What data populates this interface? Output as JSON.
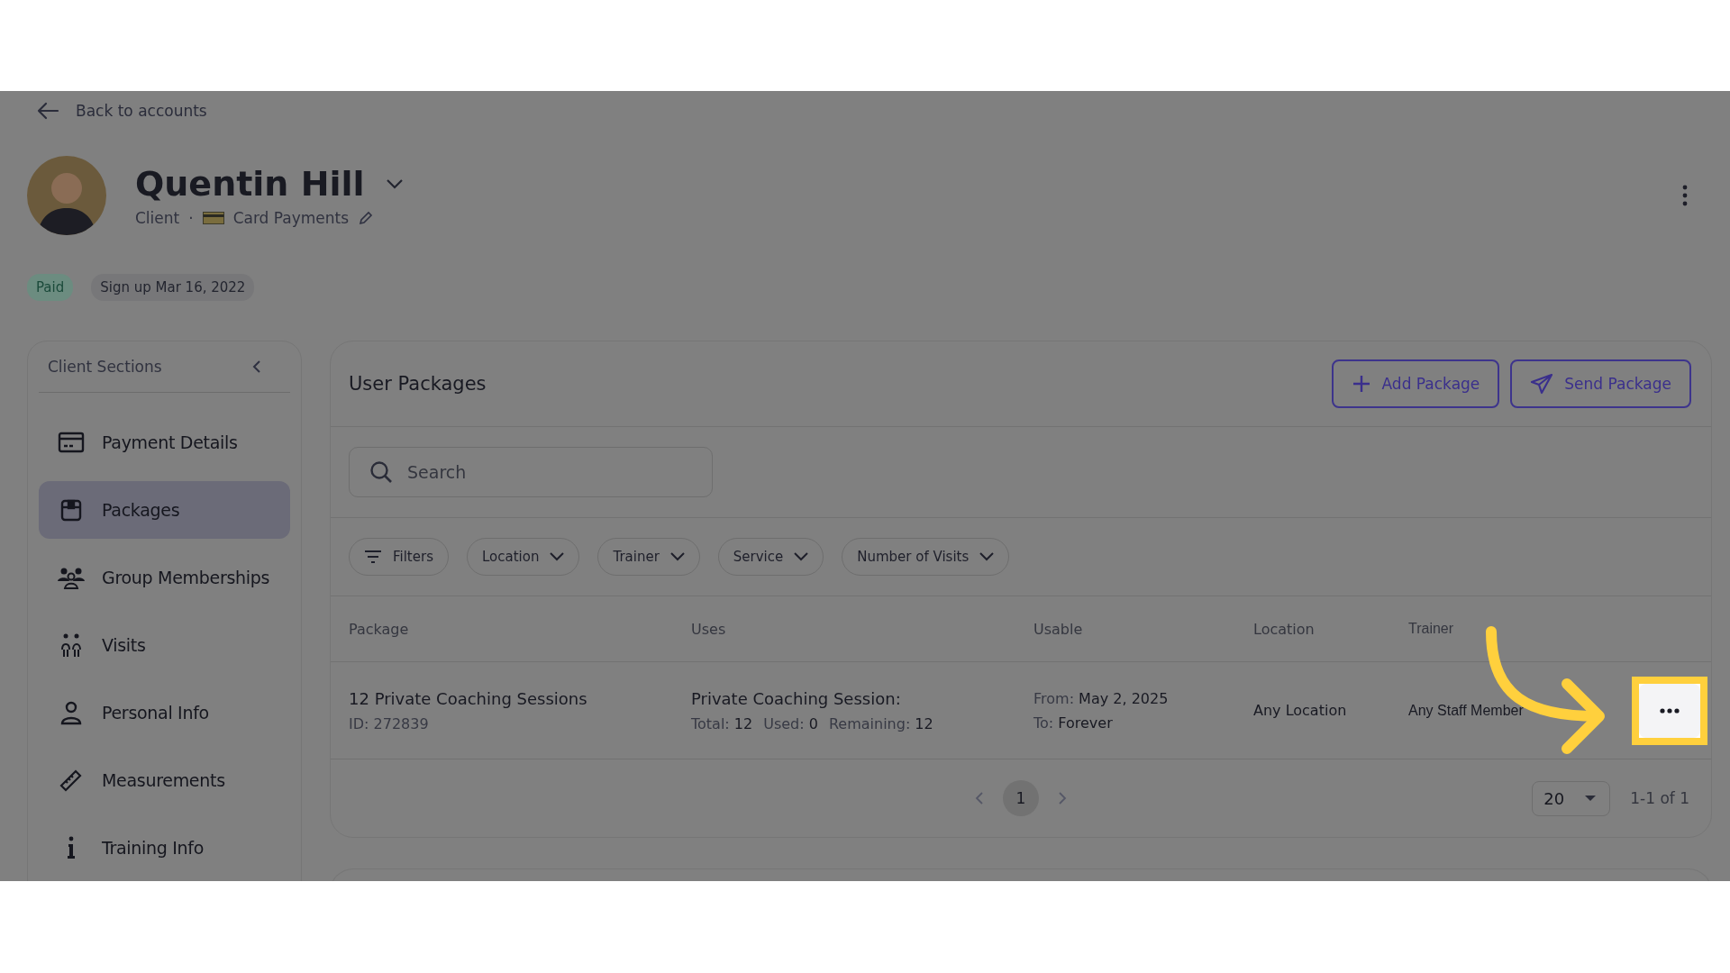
{
  "back_link": {
    "label": "Back to accounts"
  },
  "profile": {
    "name": "Quentin Hill",
    "role": "Client",
    "separator": "·",
    "payment_method": "Card Payments"
  },
  "badges": [
    {
      "label": "Paid",
      "kind": "status"
    },
    {
      "label": "Sign up Mar 16, 2022",
      "kind": "info"
    }
  ],
  "sidebar": {
    "title": "Client Sections",
    "items": [
      {
        "label": "Payment Details",
        "selected": false
      },
      {
        "label": "Packages",
        "selected": true
      },
      {
        "label": "Group Memberships",
        "selected": false
      },
      {
        "label": "Visits",
        "selected": false
      },
      {
        "label": "Personal Info",
        "selected": false
      },
      {
        "label": "Measurements",
        "selected": false
      },
      {
        "label": "Training Info",
        "selected": false
      }
    ]
  },
  "panel": {
    "title": "User Packages",
    "buttons": [
      {
        "label": "Add Package",
        "kind": "add"
      },
      {
        "label": "Send Package",
        "kind": "send"
      }
    ],
    "search": {
      "placeholder": "Search"
    },
    "filters": [
      {
        "label": "Filters",
        "kind": "filters"
      },
      {
        "label": "Location",
        "kind": "dropdown"
      },
      {
        "label": "Trainer",
        "kind": "dropdown"
      },
      {
        "label": "Service",
        "kind": "dropdown"
      },
      {
        "label": "Number of Visits",
        "kind": "dropdown"
      }
    ],
    "table": {
      "columns": [
        "Package",
        "Uses",
        "Usable",
        "Location",
        "Trainer"
      ],
      "rows": [
        {
          "package": "12 Private Coaching Sessions",
          "id": "ID: 272839",
          "uses_title": "Private Coaching Session:",
          "total_label": "Total:",
          "total": "12",
          "used_label": "Used:",
          "used": "0",
          "remaining_label": "Remaining:",
          "remaining": "12",
          "from_label": "From:",
          "from": "May 2, 2025",
          "to_label": "To:",
          "to": "Forever",
          "location": "Any Location",
          "trainer": "Any Staff Member",
          "highlighted": true
        }
      ]
    },
    "pagination": {
      "pages": [
        {
          "label": "1",
          "selected": true
        }
      ],
      "page_size": "20",
      "range": "1-1 of 1"
    }
  }
}
